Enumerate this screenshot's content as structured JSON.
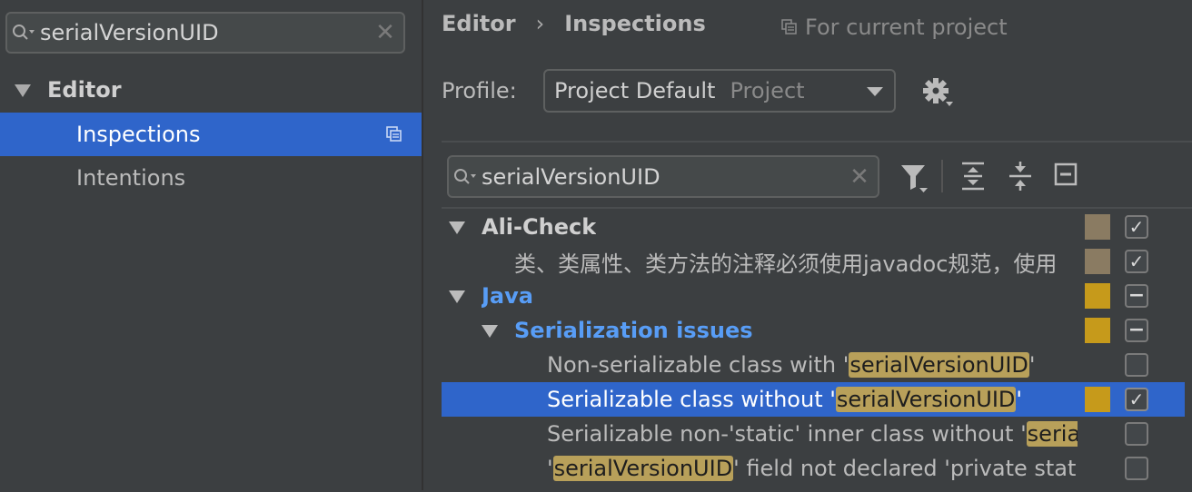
{
  "left": {
    "search": {
      "value": "serialVersionUID",
      "search_icon": "search-icon",
      "clear_icon": "close-icon"
    },
    "tree": {
      "group": "Editor",
      "items": [
        {
          "label": "Inspections",
          "selected": true,
          "icon": "copy-icon"
        },
        {
          "label": "Intentions",
          "selected": false
        }
      ]
    }
  },
  "header": {
    "breadcrumb": [
      "Editor",
      "Inspections"
    ],
    "scope": "For current project"
  },
  "profile": {
    "label": "Profile:",
    "value": "Project Default",
    "sub": "Project"
  },
  "inspection_search": {
    "value": "serialVersionUID"
  },
  "inspections": [
    {
      "kind": "category",
      "label": "Ali-Check",
      "color": "#8a7b62",
      "checked": "checked"
    },
    {
      "kind": "item",
      "label": "类、类属性、类方法的注释必须使用javadoc规范，使用",
      "color": "#8a7b62",
      "checked": "checked"
    },
    {
      "kind": "category",
      "label": "Java",
      "color": "#c69a1b",
      "checked": "mixed"
    },
    {
      "kind": "subcategory",
      "label": "Serialization issues",
      "color": "#c69a1b",
      "checked": "mixed"
    },
    {
      "kind": "item",
      "pre": "Non-serializable class with '",
      "hl": "serialVersionUID",
      "post": "'",
      "checked": "unchecked"
    },
    {
      "kind": "item",
      "pre": "Serializable class without '",
      "hl": "serialVersionUID",
      "post": "'",
      "color": "#c69a1b",
      "checked": "checked",
      "selected": true
    },
    {
      "kind": "item",
      "pre": "Serializable non-'static' inner class without '",
      "hl": "serialVersionUID",
      "post": "'",
      "checked": "unchecked"
    },
    {
      "kind": "item",
      "pre": "'",
      "hl": "serialVersionUID",
      "post": "' field not declared 'private static final long'",
      "checked": "unchecked"
    }
  ],
  "colors": {
    "accent": "#2f65ca",
    "java_blue": "#589df6",
    "highlight": "#b8a05a"
  }
}
